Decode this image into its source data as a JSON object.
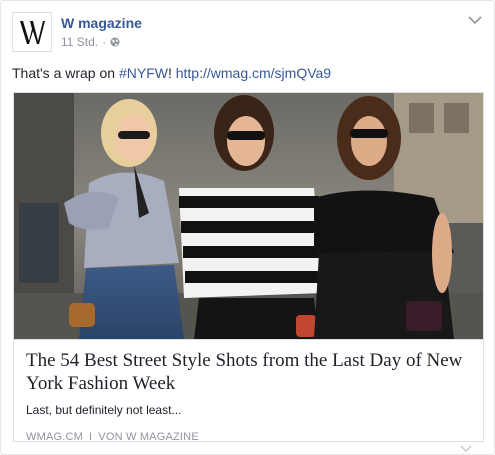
{
  "post": {
    "page_name": "W magazine",
    "timestamp": "11 Std.",
    "separator": "·",
    "privacy_icon": "globe-icon",
    "options_icon": "chevron-down-icon",
    "avatar_logo": "W",
    "text_prefix": "That's a wrap on ",
    "hashtag": "#NYFW",
    "text_middle": "! ",
    "link": "http://wmag.cm/sjmQVa9"
  },
  "card": {
    "title": "The 54 Best Street Style Shots from the Last Day of New York Fashion Week",
    "description": "Last, but definitely not least...",
    "source_domain": "WMAG.CM",
    "source_separator": "I",
    "source_author": "VON W MAGAZINE"
  },
  "colors": {
    "link": "#365899",
    "meta": "#90949c",
    "text": "#1d2129",
    "border": "#dddfe2"
  }
}
